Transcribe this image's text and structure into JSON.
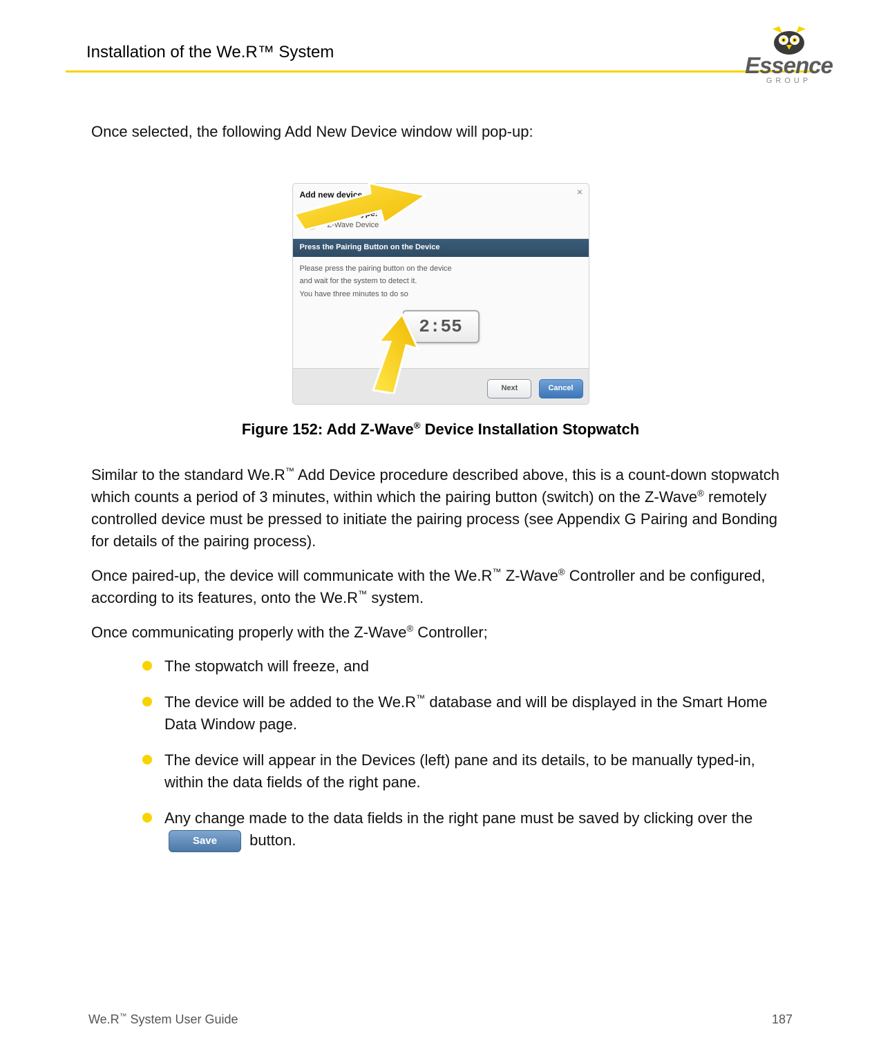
{
  "header": {
    "title": "Installation of the We.R™ System"
  },
  "logo": {
    "text": "Essence",
    "sub": "GROUP",
    "name": "essence-group-logo"
  },
  "intro": "Once selected, the following Add New Device window will pop-up:",
  "dialog": {
    "title": "Add new device",
    "icon_glyph": "((•))",
    "close_glyph": "✕",
    "type_label": "Device Type:",
    "type_value": "Z-Wave Device",
    "step_banner": "Press the Pairing Button on the Device",
    "body_line1": "Please press the pairing button on the device",
    "body_line2": "and wait for the system to detect it.",
    "body_line3": "You have three minutes to do so",
    "timer": "2:55",
    "next_label": "Next",
    "cancel_label": "Cancel"
  },
  "figure_caption": {
    "pre": "Figure 152: Add Z-Wave",
    "sup": "®",
    "post": " Device Installation Stopwatch"
  },
  "paras": {
    "p1": {
      "a": "Similar to the standard We.R",
      "s1": "™",
      "b": " Add Device procedure described above, this is a count-down stopwatch which counts a period of 3 minutes, within which the pairing button (switch) on the Z-Wave",
      "s2": "®",
      "c": " remotely controlled device must be pressed to initiate the pairing process (see Appendix G Pairing and Bonding for details of the pairing process)."
    },
    "p2": {
      "a": "Once paired-up, the device will communicate with the We.R",
      "s1": "™",
      "b": " Z-Wave",
      "s2": "®",
      "c": " Controller and be configured, according to its features, onto the We.R",
      "s3": "™",
      "d": " system."
    },
    "p3": {
      "a": "Once communicating properly with the Z-Wave",
      "s1": "®",
      "b": " Controller;"
    }
  },
  "bullets": {
    "b1": "The stopwatch will freeze, and",
    "b2a": "The device will be added to the We.R",
    "b2s": "™",
    "b2b": " database and will be displayed in the Smart Home Data Window page.",
    "b3": "The device will appear in the Devices (left) pane and its details, to be manually typed-in, within the data fields of the right pane.",
    "b4a": "Any change made to the data fields in the right pane must be saved by clicking over the ",
    "b4_save": "Save",
    "b4b": " button."
  },
  "footer": {
    "left_a": "We.R",
    "left_s": "™",
    "left_b": " System User Guide",
    "page": "187"
  }
}
